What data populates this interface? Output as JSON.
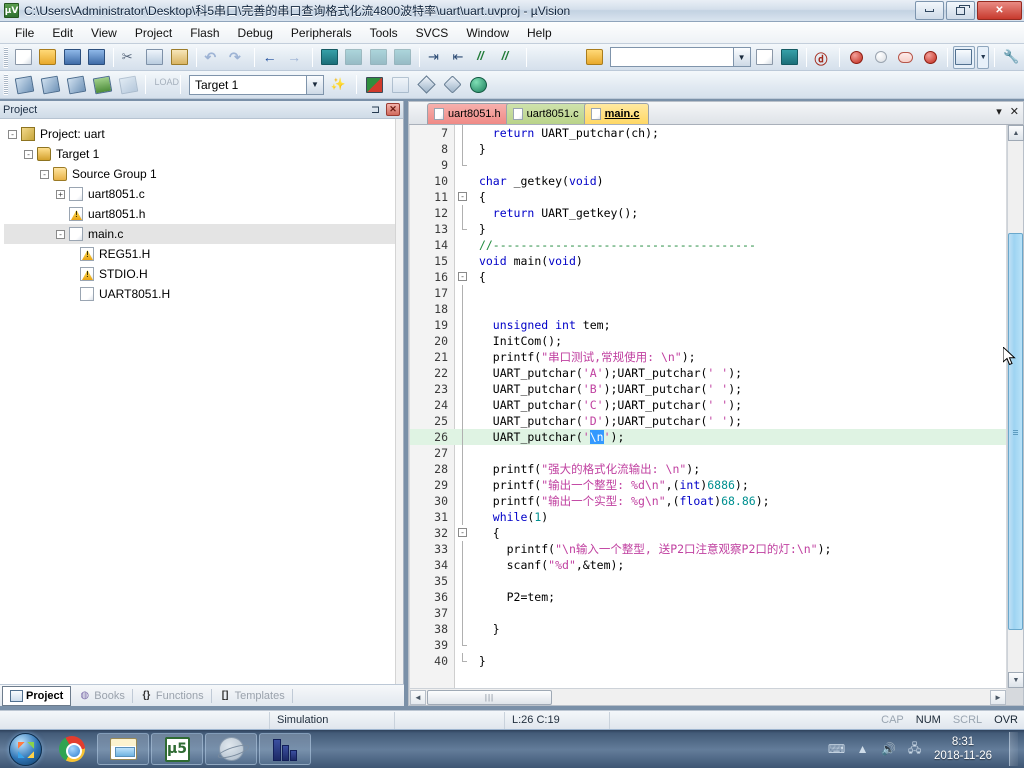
{
  "window": {
    "title": "C:\\Users\\Administrator\\Desktop\\科5串口\\完善的串口查询格式化流4800波特率\\uart\\uart.uvproj - µVision",
    "logo_text": "µV",
    "minimize_label": "Minimize",
    "maximize_label": "Restore",
    "close_label": "✕"
  },
  "menu": {
    "items": [
      {
        "label": "File"
      },
      {
        "label": "Edit"
      },
      {
        "label": "View"
      },
      {
        "label": "Project"
      },
      {
        "label": "Flash"
      },
      {
        "label": "Debug"
      },
      {
        "label": "Peripherals"
      },
      {
        "label": "Tools"
      },
      {
        "label": "SVCS"
      },
      {
        "label": "Window"
      },
      {
        "label": "Help"
      }
    ]
  },
  "toolbar1": {
    "buttons": [
      {
        "name": "new-file-icon",
        "tip": "New"
      },
      {
        "name": "open-file-icon",
        "tip": "Open"
      },
      {
        "name": "save-icon",
        "tip": "Save"
      },
      {
        "name": "save-all-icon",
        "tip": "Save All"
      },
      {
        "name": "cut-icon",
        "tip": "Cut"
      },
      {
        "name": "copy-icon",
        "tip": "Copy"
      },
      {
        "name": "paste-icon",
        "tip": "Paste"
      },
      {
        "name": "undo-icon",
        "tip": "Undo"
      },
      {
        "name": "redo-icon",
        "tip": "Redo"
      },
      {
        "name": "navigate-back-icon",
        "tip": "Back"
      },
      {
        "name": "navigate-forward-icon",
        "tip": "Forward"
      },
      {
        "name": "bookmark-toggle-icon",
        "tip": "Insert/Remove Bookmark"
      },
      {
        "name": "bookmark-prev-icon",
        "tip": "Previous Bookmark"
      },
      {
        "name": "bookmark-next-icon",
        "tip": "Next Bookmark"
      },
      {
        "name": "bookmark-clear-icon",
        "tip": "Clear All Bookmarks"
      },
      {
        "name": "indent-icon",
        "tip": "Indent"
      },
      {
        "name": "outdent-icon",
        "tip": "Outdent"
      },
      {
        "name": "comment-icon",
        "tip": "Comment"
      },
      {
        "name": "uncomment-icon",
        "tip": "Uncomment"
      }
    ]
  },
  "toolbar2": {
    "buttons": [
      {
        "name": "translate-icon",
        "tip": "Translate"
      },
      {
        "name": "build-icon",
        "tip": "Build"
      },
      {
        "name": "rebuild-icon",
        "tip": "Rebuild All"
      },
      {
        "name": "batch-build-icon",
        "tip": "Batch Build"
      },
      {
        "name": "stop-build-icon",
        "tip": "Stop Build"
      },
      {
        "name": "download-icon",
        "tip": "Download"
      }
    ],
    "target_value": "Target 1",
    "after_buttons": [
      {
        "name": "magic-wand-icon",
        "tip": "Options for Target"
      },
      {
        "name": "manage-components-icon",
        "tip": "Manage Components"
      },
      {
        "name": "multi-project-icon",
        "tip": "Multi-Project"
      },
      {
        "name": "pack-installer-icon",
        "tip": "Pack Installer"
      },
      {
        "name": "filter-icon",
        "tip": "Filter"
      },
      {
        "name": "globe-icon",
        "tip": "Manage Run-Time Environment"
      }
    ],
    "find_value": "",
    "right_buttons": [
      {
        "name": "open-folder-icon",
        "tip": "Open Project"
      },
      {
        "name": "find-in-files-icon",
        "tip": "Find in Files"
      },
      {
        "name": "bookmark-blue-icon",
        "tip": "Bookmarks"
      },
      {
        "name": "debug-start-icon",
        "tip": "Start/Stop Debug"
      },
      {
        "name": "breakpoint-insert-icon",
        "tip": "Insert/Remove Breakpoint"
      },
      {
        "name": "breakpoint-disable-icon",
        "tip": "Enable/Disable Breakpoint"
      },
      {
        "name": "breakpoint-disable-all-icon",
        "tip": "Disable All Breakpoints"
      },
      {
        "name": "breakpoint-kill-all-icon",
        "tip": "Kill All Breakpoints"
      },
      {
        "name": "project-window-icon",
        "tip": "Project Window"
      },
      {
        "name": "configuration-wizard-icon",
        "tip": "Configuration Wizard"
      }
    ]
  },
  "project_panel": {
    "title": "Project",
    "pin_label": "⊐",
    "close_label": "✕",
    "tree": [
      {
        "indent": 0,
        "expander": "-",
        "icon": "project-icon",
        "label": "Project: uart",
        "selected": false
      },
      {
        "indent": 1,
        "expander": "-",
        "icon": "target-icon",
        "label": "Target 1",
        "selected": false
      },
      {
        "indent": 2,
        "expander": "-",
        "icon": "folder-icon",
        "label": "Source Group 1",
        "selected": false
      },
      {
        "indent": 3,
        "expander": "+",
        "icon": "c-file-icon",
        "label": "uart8051.c",
        "selected": false
      },
      {
        "indent": 3,
        "expander": "",
        "icon": "h-file-icon",
        "label": "uart8051.h",
        "selected": false
      },
      {
        "indent": 3,
        "expander": "-",
        "icon": "c-file-icon",
        "label": "main.c",
        "selected": true
      },
      {
        "indent": 4,
        "expander": "",
        "icon": "warn-file-icon",
        "label": "REG51.H",
        "selected": false
      },
      {
        "indent": 4,
        "expander": "",
        "icon": "warn-file-icon",
        "label": "STDIO.H",
        "selected": false
      },
      {
        "indent": 4,
        "expander": "",
        "icon": "h-file-icon",
        "label": "UART8051.H",
        "selected": false
      }
    ],
    "bottom_tabs": [
      {
        "label": "Project",
        "icon": "project-window-icon",
        "active": true
      },
      {
        "label": "Books",
        "icon": "books-icon",
        "active": false
      },
      {
        "label": "Functions",
        "icon": "braces-icon",
        "active": false
      },
      {
        "label": "Templates",
        "icon": "templates-icon",
        "active": false
      }
    ]
  },
  "editor": {
    "tabs": [
      {
        "label": "uart8051.h",
        "color": "red",
        "active": false
      },
      {
        "label": "uart8051.c",
        "color": "green",
        "active": false
      },
      {
        "label": "main.c",
        "color": "yellow",
        "active": true
      }
    ],
    "tab_dropdown_label": "▾",
    "tab_close_label": "✕",
    "lines": [
      {
        "n": "7",
        "fold": "bar",
        "html": "   <span class='kw'>return</span> UART_putchar(ch);"
      },
      {
        "n": "8",
        "fold": "bar",
        "html": " }"
      },
      {
        "n": "9",
        "fold": "end",
        "html": ""
      },
      {
        "n": "10",
        "fold": "",
        "html": " <span class='kw'>char</span> _getkey(<span class='kw'>void</span>)"
      },
      {
        "n": "11",
        "fold": "box-",
        "html": " {"
      },
      {
        "n": "12",
        "fold": "bar",
        "html": "   <span class='kw'>return</span> UART_getkey();"
      },
      {
        "n": "13",
        "fold": "end",
        "html": " }"
      },
      {
        "n": "14",
        "fold": "",
        "html": " <span class='cmt'>//--------------------------------------</span>"
      },
      {
        "n": "15",
        "fold": "",
        "html": " <span class='kw'>void</span> main(<span class='kw'>void</span>)"
      },
      {
        "n": "16",
        "fold": "box-",
        "html": " {"
      },
      {
        "n": "17",
        "fold": "bar",
        "html": ""
      },
      {
        "n": "18",
        "fold": "bar",
        "html": ""
      },
      {
        "n": "19",
        "fold": "bar",
        "html": "   <span class='kw'>unsigned int</span> tem;"
      },
      {
        "n": "20",
        "fold": "bar",
        "html": "   InitCom();"
      },
      {
        "n": "21",
        "fold": "bar",
        "html": "   printf(<span class='str'>\"串口测试,常规使用: \\n\"</span>);"
      },
      {
        "n": "22",
        "fold": "bar",
        "html": "   UART_putchar(<span class='str'>'A'</span>);UART_putchar(<span class='str'>' '</span>);"
      },
      {
        "n": "23",
        "fold": "bar",
        "html": "   UART_putchar(<span class='str'>'B'</span>);UART_putchar(<span class='str'>' '</span>);"
      },
      {
        "n": "24",
        "fold": "bar",
        "html": "   UART_putchar(<span class='str'>'C'</span>);UART_putchar(<span class='str'>' '</span>);"
      },
      {
        "n": "25",
        "fold": "bar",
        "html": "   UART_putchar(<span class='str'>'D'</span>);UART_putchar(<span class='str'>' '</span>);"
      },
      {
        "n": "26",
        "fold": "bar",
        "highlight": true,
        "html": "   UART_putchar(<span class='str'>'</span><span class='sel-char'>\\n</span><span class='str'>'</span>);"
      },
      {
        "n": "27",
        "fold": "bar",
        "html": ""
      },
      {
        "n": "28",
        "fold": "bar",
        "html": "   printf(<span class='str'>\"强大的格式化流输出: \\n\"</span>);"
      },
      {
        "n": "29",
        "fold": "bar",
        "html": "   printf(<span class='str'>\"输出一个整型: %d\\n\"</span>,(<span class='kw'>int</span>)<span class='num'>6886</span>);"
      },
      {
        "n": "30",
        "fold": "bar",
        "html": "   printf(<span class='str'>\"输出一个实型: %g\\n\"</span>,(<span class='kw'>float</span>)<span class='num'>68.86</span>);"
      },
      {
        "n": "31",
        "fold": "bar",
        "html": "   <span class='kw'>while</span>(<span class='num'>1</span>)"
      },
      {
        "n": "32",
        "fold": "box-",
        "html": "   {"
      },
      {
        "n": "33",
        "fold": "bar",
        "html": "     printf(<span class='str'>\"\\n输入一个整型, 送P2口注意观察P2口的灯:\\n\"</span>);"
      },
      {
        "n": "34",
        "fold": "bar",
        "html": "     scanf(<span class='str'>\"%d\"</span>,&amp;tem);"
      },
      {
        "n": "35",
        "fold": "bar",
        "html": ""
      },
      {
        "n": "36",
        "fold": "bar",
        "html": "     P2=tem;"
      },
      {
        "n": "37",
        "fold": "bar",
        "html": ""
      },
      {
        "n": "38",
        "fold": "bar",
        "html": "   }"
      },
      {
        "n": "39",
        "fold": "end",
        "html": ""
      },
      {
        "n": "40",
        "fold": "end",
        "html": " }"
      }
    ],
    "hscroll_grip": "|||",
    "scroll_up_label": "▲",
    "scroll_down_label": "▼",
    "scroll_left_label": "◄",
    "scroll_right_label": "►"
  },
  "statusbar": {
    "mode": "Simulation",
    "cursor_position": "L:26 C:19",
    "flags": [
      {
        "label": "CAP",
        "on": false
      },
      {
        "label": "NUM",
        "on": true
      },
      {
        "label": "SCRL",
        "on": false
      },
      {
        "label": "OVR",
        "on": true
      }
    ]
  },
  "taskbar": {
    "start_label": "Start",
    "items": [
      {
        "name": "taskbar-chrome",
        "label": "Google Chrome"
      },
      {
        "name": "taskbar-explorer",
        "label": "Windows Explorer"
      },
      {
        "name": "taskbar-uvision",
        "label": "µVision5"
      },
      {
        "name": "taskbar-browser",
        "label": "Internet Explorer"
      },
      {
        "name": "taskbar-app",
        "label": "Application"
      }
    ],
    "tray": [
      {
        "name": "keyboard-icon",
        "glyph": "⌨"
      },
      {
        "name": "show-hidden-icons-icon",
        "glyph": "▲"
      },
      {
        "name": "volume-icon",
        "glyph": "🔊"
      },
      {
        "name": "network-icon",
        "glyph": "🖧"
      }
    ],
    "clock_time": "8:31",
    "clock_date": "2018-11-26"
  }
}
